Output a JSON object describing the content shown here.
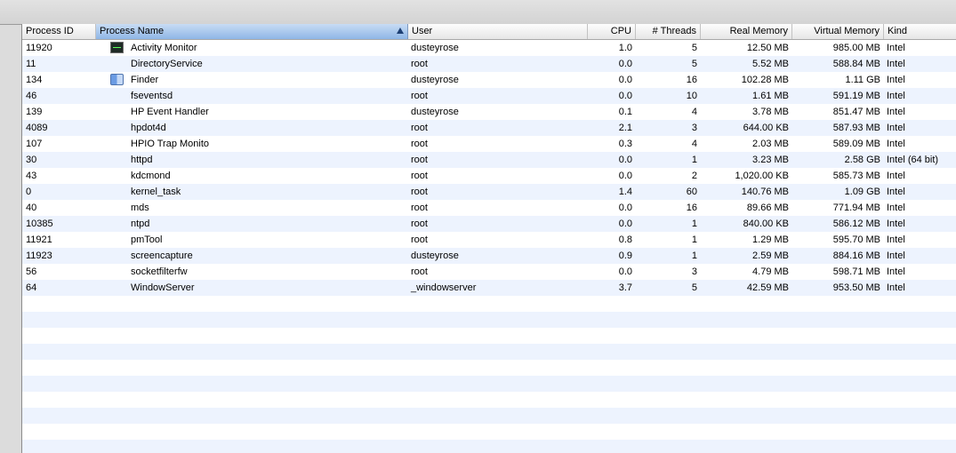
{
  "columns": {
    "pid": "Process ID",
    "name": "Process Name",
    "user": "User",
    "cpu": "CPU",
    "threads": "# Threads",
    "real": "Real Memory",
    "virtual": "Virtual Memory",
    "kind": "Kind"
  },
  "sort": {
    "column": "name",
    "direction": "ascending"
  },
  "rows": [
    {
      "pid": "11920",
      "name": "Activity Monitor",
      "icon": "activity-monitor-icon",
      "user": "dusteyrose",
      "cpu": "1.0",
      "threads": "5",
      "real": "12.50 MB",
      "virtual": "985.00 MB",
      "kind": "Intel"
    },
    {
      "pid": "11",
      "name": "DirectoryService",
      "user": "root",
      "cpu": "0.0",
      "threads": "5",
      "real": "5.52 MB",
      "virtual": "588.84 MB",
      "kind": "Intel"
    },
    {
      "pid": "134",
      "name": "Finder",
      "icon": "finder-icon",
      "user": "dusteyrose",
      "cpu": "0.0",
      "threads": "16",
      "real": "102.28 MB",
      "virtual": "1.11 GB",
      "kind": "Intel"
    },
    {
      "pid": "46",
      "name": "fseventsd",
      "user": "root",
      "cpu": "0.0",
      "threads": "10",
      "real": "1.61 MB",
      "virtual": "591.19 MB",
      "kind": "Intel"
    },
    {
      "pid": "139",
      "name": "HP Event Handler",
      "user": "dusteyrose",
      "cpu": "0.1",
      "threads": "4",
      "real": "3.78 MB",
      "virtual": "851.47 MB",
      "kind": "Intel"
    },
    {
      "pid": "4089",
      "name": "hpdot4d",
      "user": "root",
      "cpu": "2.1",
      "threads": "3",
      "real": "644.00 KB",
      "virtual": "587.93 MB",
      "kind": "Intel"
    },
    {
      "pid": "107",
      "name": "HPIO Trap Monito",
      "user": "root",
      "cpu": "0.3",
      "threads": "4",
      "real": "2.03 MB",
      "virtual": "589.09 MB",
      "kind": "Intel"
    },
    {
      "pid": "30",
      "name": "httpd",
      "user": "root",
      "cpu": "0.0",
      "threads": "1",
      "real": "3.23 MB",
      "virtual": "2.58 GB",
      "kind": "Intel (64 bit)"
    },
    {
      "pid": "43",
      "name": "kdcmond",
      "user": "root",
      "cpu": "0.0",
      "threads": "2",
      "real": "1,020.00 KB",
      "virtual": "585.73 MB",
      "kind": "Intel"
    },
    {
      "pid": "0",
      "name": "kernel_task",
      "user": "root",
      "cpu": "1.4",
      "threads": "60",
      "real": "140.76 MB",
      "virtual": "1.09 GB",
      "kind": "Intel"
    },
    {
      "pid": "40",
      "name": "mds",
      "user": "root",
      "cpu": "0.0",
      "threads": "16",
      "real": "89.66 MB",
      "virtual": "771.94 MB",
      "kind": "Intel"
    },
    {
      "pid": "10385",
      "name": "ntpd",
      "user": "root",
      "cpu": "0.0",
      "threads": "1",
      "real": "840.00 KB",
      "virtual": "586.12 MB",
      "kind": "Intel"
    },
    {
      "pid": "11921",
      "name": "pmTool",
      "user": "root",
      "cpu": "0.8",
      "threads": "1",
      "real": "1.29 MB",
      "virtual": "595.70 MB",
      "kind": "Intel"
    },
    {
      "pid": "11923",
      "name": "screencapture",
      "user": "dusteyrose",
      "cpu": "0.9",
      "threads": "1",
      "real": "2.59 MB",
      "virtual": "884.16 MB",
      "kind": "Intel"
    },
    {
      "pid": "56",
      "name": "socketfilterfw",
      "user": "root",
      "cpu": "0.0",
      "threads": "3",
      "real": "4.79 MB",
      "virtual": "598.71 MB",
      "kind": "Intel"
    },
    {
      "pid": "64",
      "name": "WindowServer",
      "user": "_windowserver",
      "cpu": "3.7",
      "threads": "5",
      "real": "42.59 MB",
      "virtual": "953.50 MB",
      "kind": "Intel"
    }
  ],
  "colors": {
    "row_alt": "#edf3fe",
    "sorted_header": "#8fb6e6"
  }
}
